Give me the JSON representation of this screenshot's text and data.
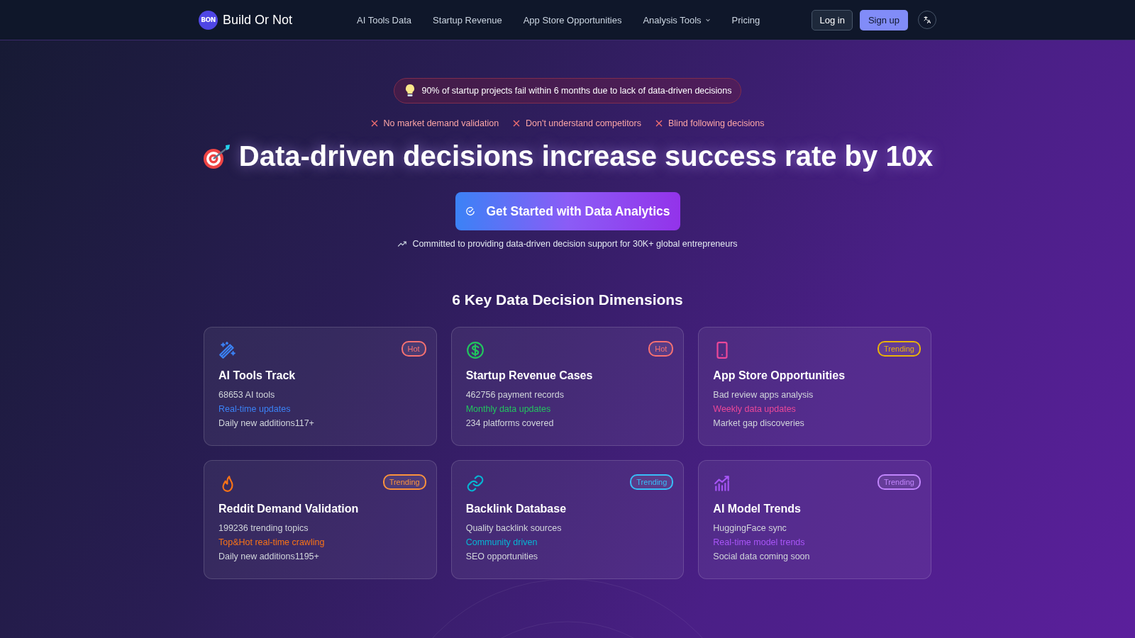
{
  "nav": {
    "logo_mark": "BON",
    "brand": "Build Or Not",
    "links": [
      {
        "label": "AI Tools Data",
        "dropdown": false
      },
      {
        "label": "Startup Revenue",
        "dropdown": false
      },
      {
        "label": "App Store Opportunities",
        "dropdown": false
      },
      {
        "label": "Analysis Tools",
        "dropdown": true
      },
      {
        "label": "Pricing",
        "dropdown": false
      }
    ],
    "login": "Log in",
    "signup": "Sign up"
  },
  "hero": {
    "alert": "90% of startup projects fail within 6 months due to lack of data-driven decisions",
    "problems": [
      "No market demand validation",
      "Don't understand competitors",
      "Blind following decisions"
    ],
    "headline": "Data-driven decisions increase success rate by 10x",
    "cta": "Get Started with Data Analytics",
    "commitment": "Committed to providing data-driven decision support for 30K+ global entrepreneurs"
  },
  "dimensions": {
    "title": "6 Key Data Decision Dimensions",
    "cards": [
      {
        "kind": "wand",
        "color": "#3b82f6",
        "title": "AI Tools Track",
        "badge": {
          "label": "Hot",
          "color": "#f87171"
        },
        "lines": [
          "68653 AI tools",
          "Real-time updates",
          "Daily new additions117+"
        ]
      },
      {
        "kind": "dollar",
        "color": "#22c55e",
        "title": "Startup Revenue Cases",
        "badge": {
          "label": "Hot",
          "color": "#f87171"
        },
        "lines": [
          "462756 payment records",
          "Monthly data updates",
          "234 platforms covered"
        ]
      },
      {
        "kind": "phone",
        "color": "#ec4899",
        "title": "App Store Opportunities",
        "badge": {
          "label": "Trending",
          "color": "#eab308"
        },
        "lines": [
          "Bad review apps analysis",
          "Weekly data updates",
          "Market gap discoveries"
        ]
      },
      {
        "kind": "flame",
        "color": "#f97316",
        "title": "Reddit Demand Validation",
        "badge": {
          "label": "Trending",
          "color": "#fb923c"
        },
        "lines": [
          "199236 trending topics",
          "Top&Hot real-time crawling",
          "Daily new additions1195+"
        ]
      },
      {
        "kind": "link",
        "color": "#06b6d4",
        "title": "Backlink Database",
        "badge": {
          "label": "Trending",
          "color": "#38bdf8"
        },
        "lines": [
          "Quality backlink sources",
          "Community driven",
          "SEO opportunities"
        ]
      },
      {
        "kind": "chart",
        "color": "#a855f7",
        "title": "AI Model Trends",
        "badge": {
          "label": "Trending",
          "color": "#c084fc"
        },
        "lines": [
          "HuggingFace sync",
          "Real-time model trends",
          "Social data coming soon"
        ]
      }
    ]
  }
}
